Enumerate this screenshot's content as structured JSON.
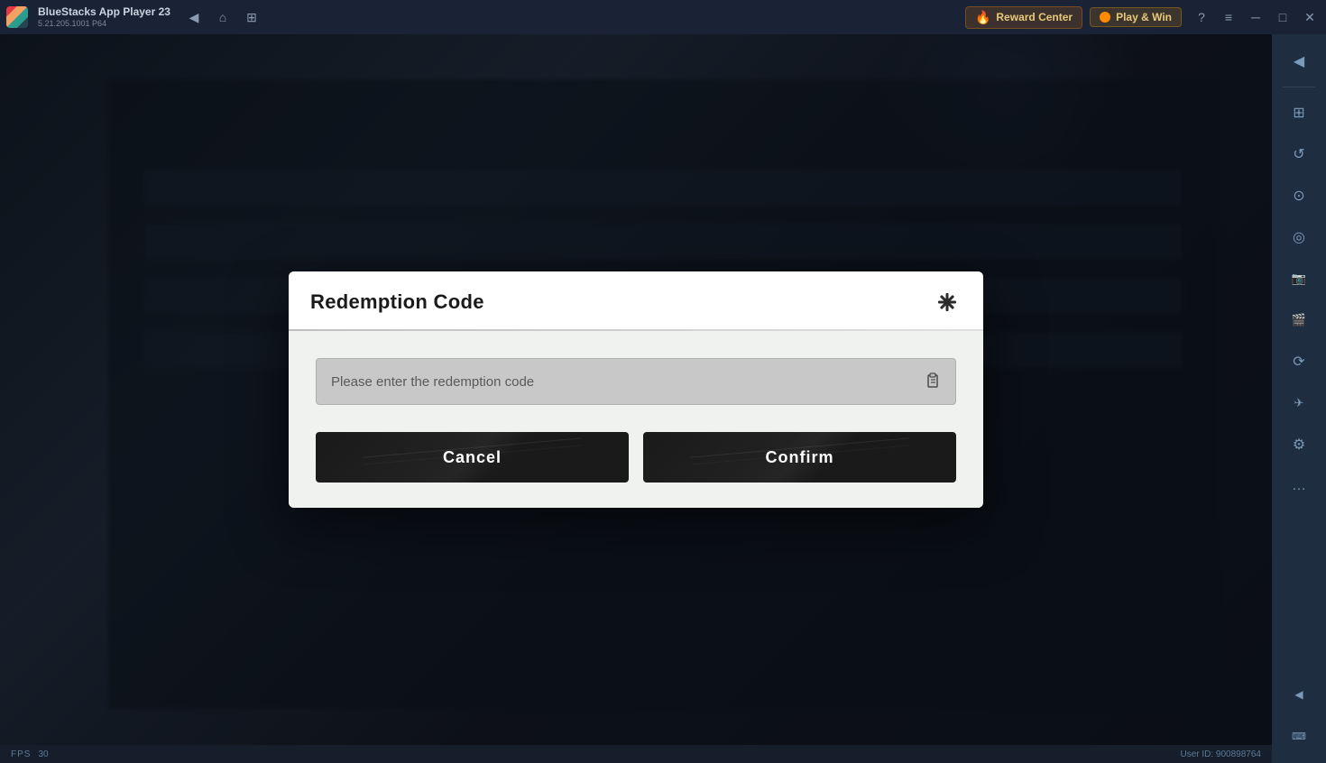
{
  "titlebar": {
    "app_name": "BlueStacks App Player 23",
    "app_version": "5.21.205.1001 P64",
    "reward_center_label": "Reward Center",
    "play_win_label": "Play & Win",
    "nav_back_icon": "◀",
    "nav_home_icon": "⌂",
    "nav_tabs_icon": "⊞",
    "help_icon": "?",
    "menu_icon": "≡",
    "minimize_icon": "─",
    "maximize_icon": "□",
    "close_icon": "✕"
  },
  "dialog": {
    "title": "Redemption Code",
    "close_icon": "✕",
    "input_placeholder": "Please enter the redemption code",
    "paste_icon": "⧉",
    "cancel_label": "Cancel",
    "confirm_label": "Confirm"
  },
  "sidebar_right": {
    "buttons": [
      {
        "icon": "◀",
        "name": "collapse"
      },
      {
        "icon": "⊞",
        "name": "app-grid"
      },
      {
        "icon": "↺",
        "name": "rotate"
      },
      {
        "icon": "⊙",
        "name": "record"
      },
      {
        "icon": "⊘",
        "name": "performance"
      },
      {
        "icon": "📸",
        "name": "screenshot"
      },
      {
        "icon": "🎬",
        "name": "video"
      },
      {
        "icon": "⟳",
        "name": "refresh"
      },
      {
        "icon": "✈",
        "name": "gps"
      },
      {
        "icon": "⚙",
        "name": "settings"
      },
      {
        "icon": "…",
        "name": "more"
      }
    ]
  },
  "bottom_bar": {
    "fps_label": "FPS",
    "fps_value": "30",
    "user_id_label": "User ID: 900898764"
  }
}
